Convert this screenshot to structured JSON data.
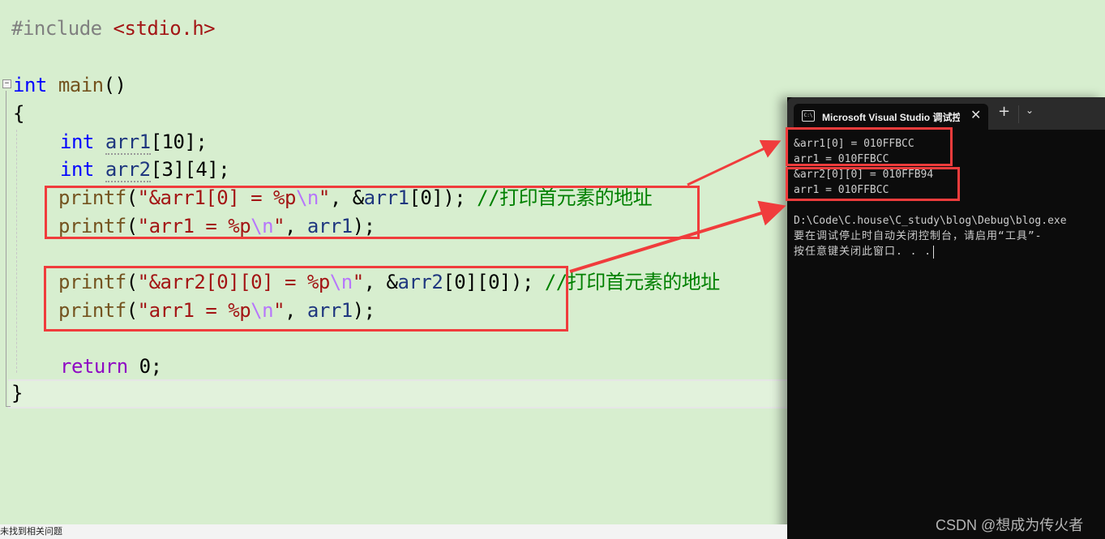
{
  "editor": {
    "lines": {
      "include_directive": "#include",
      "include_header": "<stdio.h>",
      "main_kw": "int",
      "main_name": "main",
      "main_parens": "()",
      "open_brace": "{",
      "decl1_kw": "int",
      "decl1_var": "arr1",
      "decl1_rest": "[10];",
      "decl2_kw": "int",
      "decl2_var": "arr2",
      "decl2_rest": "[3][4];",
      "p1_fn": "printf",
      "p1_open": "(",
      "p1_str": "\"&arr1[0] = %p",
      "p1_esc": "\\n",
      "p1_strend": "\"",
      "p1_sep": ", &",
      "p1_var": "arr1",
      "p1_rest": "[0]);",
      "p1_comment": "//打印首元素的地址",
      "p2_fn": "printf",
      "p2_open": "(",
      "p2_str": "\"arr1 = %p",
      "p2_esc": "\\n",
      "p2_strend": "\"",
      "p2_sep": ", ",
      "p2_var": "arr1",
      "p2_rest": ");",
      "p3_fn": "printf",
      "p3_open": "(",
      "p3_str": "\"&arr2[0][0] = %p",
      "p3_esc": "\\n",
      "p3_strend": "\"",
      "p3_sep": ", &",
      "p3_var": "arr2",
      "p3_rest": "[0][0]);",
      "p3_comment": "//打印首元素的地址",
      "p4_fn": "printf",
      "p4_open": "(",
      "p4_str": "\"arr1 = %p",
      "p4_esc": "\\n",
      "p4_strend": "\"",
      "p4_sep": ", ",
      "p4_var": "arr1",
      "p4_rest": ");",
      "ret_kw": "return",
      "ret_val": "0;",
      "close_brace": "}"
    },
    "fold_glyph": "−"
  },
  "console": {
    "tab_icon_text": "C:\\",
    "tab_title": "Microsoft Visual Studio 调试控制台",
    "close_glyph": "✕",
    "new_tab_glyph": "+",
    "dropdown_glyph": "⌄",
    "output": [
      "&arr1[0] = 010FFBCC",
      "arr1 = 010FFBCC",
      "&arr2[0][0] = 010FFB94",
      "arr1 = 010FFBCC",
      "",
      "D:\\Code\\C.house\\C_study\\blog\\Debug\\blog.exe",
      "要在调试停止时自动关闭控制台，请启用“工具”-",
      "按任意键关闭此窗口. . ."
    ],
    "watermark": "CSDN @想成为传火者"
  },
  "statusbar": {
    "message": "未找到相关问题"
  },
  "colors": {
    "annotation": "#f03c3c",
    "editor_bg": "#d7eecf",
    "console_bg": "#0c0c0c"
  }
}
